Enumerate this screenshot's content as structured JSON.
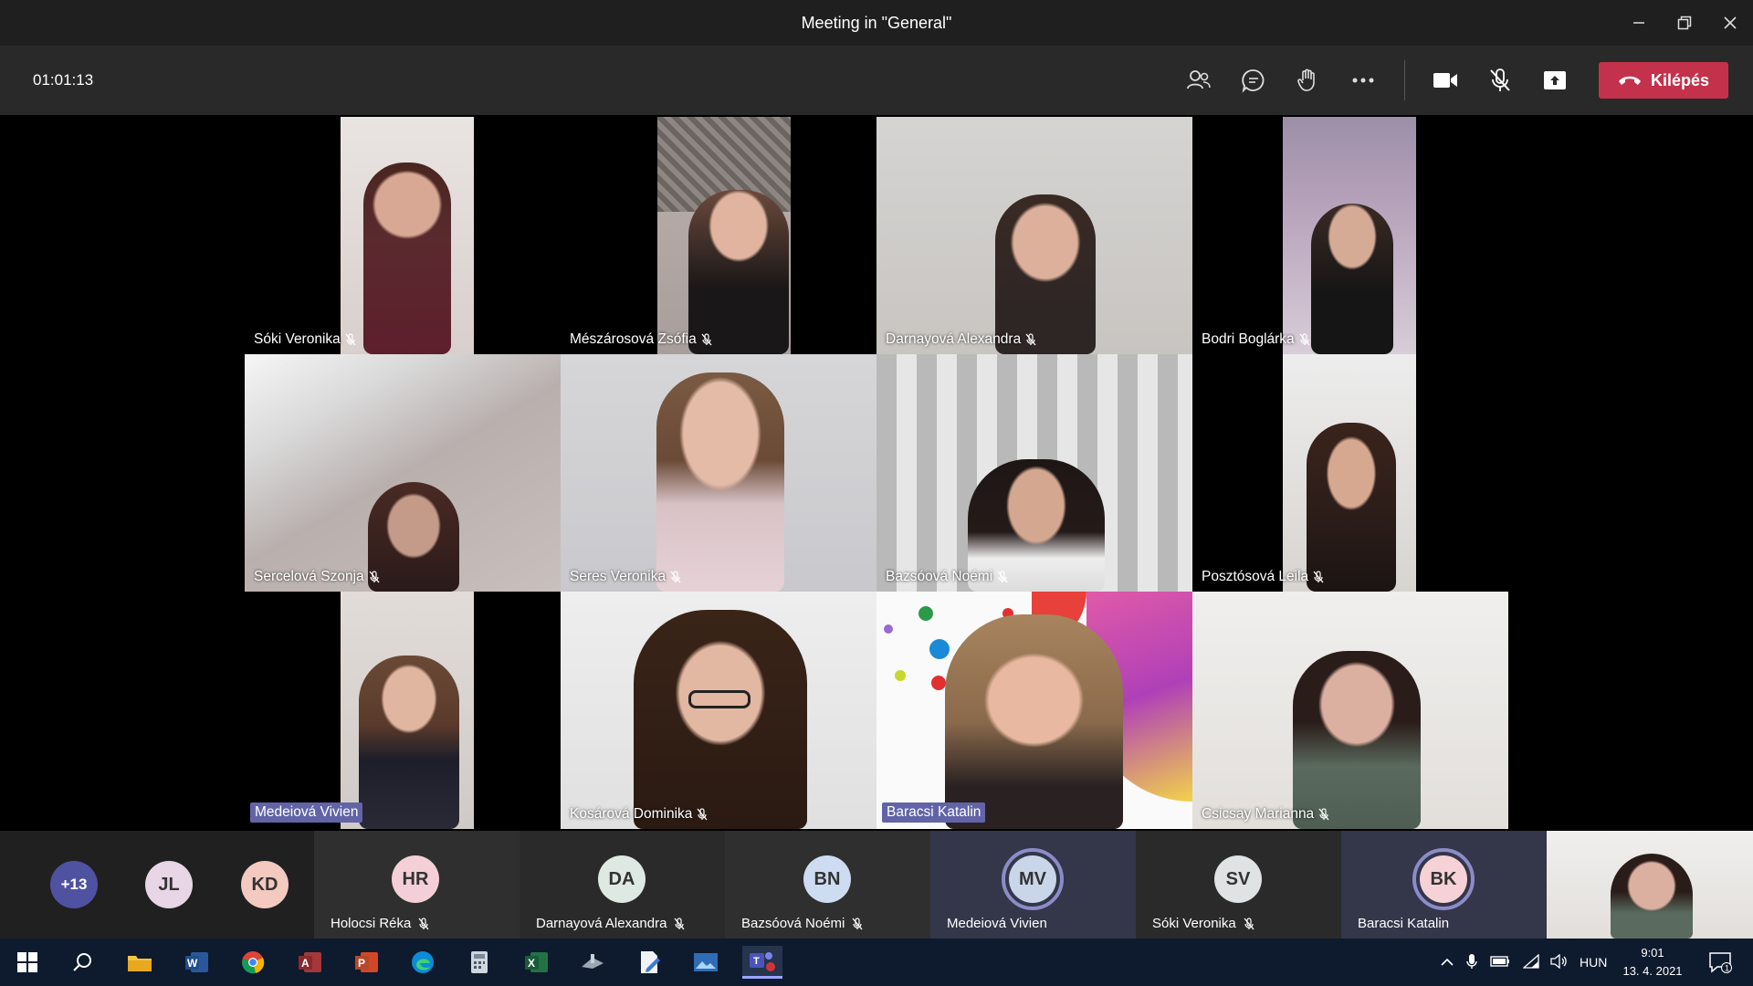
{
  "window": {
    "title": "Meeting in \"General\""
  },
  "toolbar": {
    "timer": "01:01:13",
    "leave_label": "Kilépés",
    "accent": "#c4314b",
    "icons": [
      "participants-icon",
      "chat-icon",
      "raise-hand-icon",
      "more-icon",
      "camera-icon",
      "mic-off-icon",
      "share-icon"
    ]
  },
  "tiles": [
    {
      "name": "Sóki Veronika",
      "muted": true
    },
    {
      "name": "Mészárosová Zsófia",
      "muted": true
    },
    {
      "name": "Darnayová Alexandra",
      "muted": true
    },
    {
      "name": "Bodri Boglárka",
      "muted": true
    },
    {
      "name": "Sercelová Szonja",
      "muted": true
    },
    {
      "name": "Seres Veronika",
      "muted": true
    },
    {
      "name": "Bazsóová Noémi",
      "muted": true
    },
    {
      "name": "Posztósová Leila",
      "muted": true
    },
    {
      "name": "Medeiová Vivien",
      "muted": false,
      "speaking": true
    },
    {
      "name": "Kosárová Dominika",
      "muted": true
    },
    {
      "name": "Baracsi Katalin",
      "muted": false,
      "speaking": true
    },
    {
      "name": "Csicsay Marianna",
      "muted": true
    }
  ],
  "strip": {
    "overflow": "+13",
    "small": [
      {
        "initials": "JL",
        "color": "#e8d6e6"
      },
      {
        "initials": "KD",
        "color": "#f3c9c0"
      }
    ],
    "chips": [
      {
        "initials": "HR",
        "name": "Holocsi Réka",
        "color": "#f4cfd8",
        "muted": true
      },
      {
        "initials": "DA",
        "name": "Darnayová Alexandra",
        "color": "#dfe9e4",
        "muted": true
      },
      {
        "initials": "BN",
        "name": "Bazsóová Noémi",
        "color": "#cddcf0",
        "muted": true
      },
      {
        "initials": "MV",
        "name": "Medeiová Vivien",
        "color": "#c9d6ea",
        "muted": false
      },
      {
        "initials": "SV",
        "name": "Sóki Veronika",
        "color": "#dfe3e4",
        "muted": true
      },
      {
        "initials": "BK",
        "name": "Baracsi Katalin",
        "color": "#f6d1d6",
        "muted": false
      }
    ]
  },
  "taskbar": {
    "apps": [
      "start-icon",
      "search-icon",
      "file-explorer-icon",
      "word-icon",
      "chrome-icon",
      "access-icon",
      "powerpoint-icon",
      "edge-icon",
      "calculator-icon",
      "excel-icon",
      "app-icon",
      "notepad-icon",
      "photos-icon",
      "teams-icon"
    ],
    "lang": "HUN",
    "time": "9:01",
    "date": "13. 4. 2021",
    "notifications": "1"
  }
}
